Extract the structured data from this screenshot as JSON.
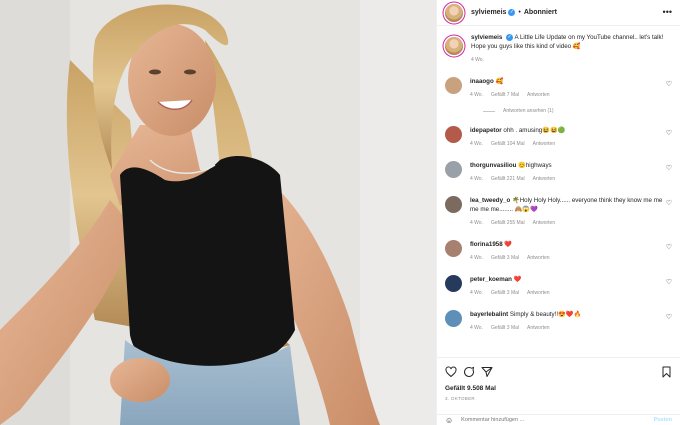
{
  "post": {
    "username": "sylviemeis",
    "separator": "•",
    "follow_state": "Abonniert",
    "more_glyph": "•••"
  },
  "caption": {
    "username": "sylviemeis",
    "text": "A Little Life Update on my YouTube channel.. let's talk! Hope you guys like this kind of video 🥰",
    "age": "4 Wo."
  },
  "comments": [
    {
      "username": "inaaogo",
      "text": "🥰",
      "age": "4 Wo.",
      "likes": "Gefällt 7 Mal",
      "reply": "Antworten",
      "avatar": "#c8a27e"
    },
    {
      "username": "idepapetor",
      "text": "ohh . amusing😆😆🟢",
      "age": "4 Wo.",
      "likes": "Gefällt 104 Mal",
      "reply": "Antworten",
      "avatar": "#b35a4a"
    },
    {
      "username": "thorgunvasiliou",
      "text": "😊highways",
      "age": "4 Wo.",
      "likes": "Gefällt 221 Mal",
      "reply": "Antworten",
      "avatar": "#9aa0a8"
    },
    {
      "username": "lea_tweedy_o",
      "text": "🌴Holy Holy Holy...... everyone think they know me me me me me........ 🙈😱💜",
      "age": "4 Wo.",
      "likes": "Gefällt 255 Mal",
      "reply": "Antworten",
      "avatar": "#7d6a5e"
    },
    {
      "username": "florina1958",
      "text": "❤️",
      "age": "4 Wo.",
      "likes": "Gefällt 3 Mal",
      "reply": "Antworten",
      "avatar": "#a88070"
    },
    {
      "username": "peter_koeman",
      "text": "❤️",
      "age": "4 Wo.",
      "likes": "Gefällt 3 Mal",
      "reply": "Antworten",
      "avatar": "#263a5e"
    },
    {
      "username": "bayerlebalint",
      "text": "Simply & beauty!!😍❤️🔥",
      "age": "4 Wo.",
      "likes": "Gefällt 3 Mal",
      "reply": "Antworten",
      "avatar": "#5d8fb8"
    }
  ],
  "replies_link": "Antworten ansehen (1)",
  "likes_total": "Gefällt 9.508 Mal",
  "post_date": "3. OKTOBER",
  "add_comment": {
    "placeholder": "Kommentar hinzufügen ...",
    "post_label": "Posten"
  },
  "icons": [
    "heart-icon",
    "comment-icon",
    "share-icon",
    "bookmark-icon",
    "smiley-icon",
    "verified-badge-icon",
    "more-options-icon"
  ],
  "colors": {
    "accent": "#3897f0",
    "text": "#262626",
    "muted": "#8e8e8e",
    "heart_red": "#e0245e"
  }
}
